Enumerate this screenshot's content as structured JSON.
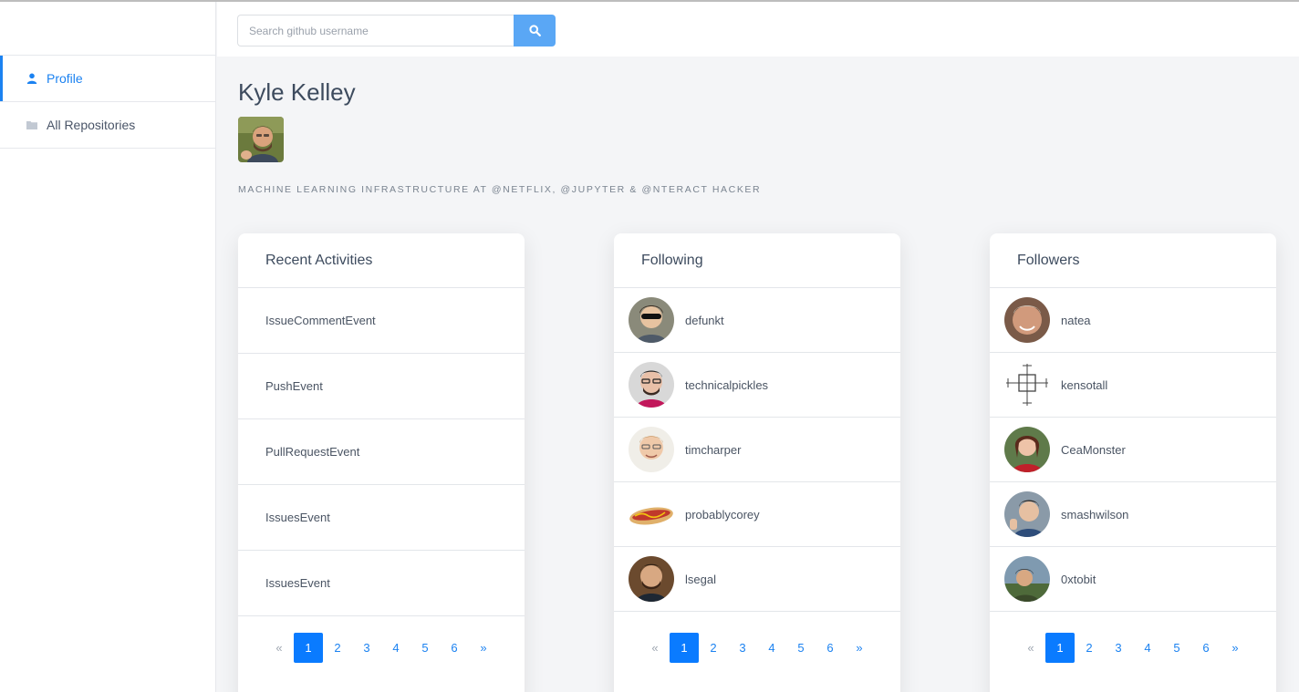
{
  "search": {
    "placeholder": "Search github username"
  },
  "sidebar": {
    "items": [
      {
        "label": "Profile",
        "icon": "user-icon",
        "active": true
      },
      {
        "label": "All Repositories",
        "icon": "folder-icon",
        "active": false
      }
    ]
  },
  "profile": {
    "name": "Kyle Kelley",
    "bio": "MACHINE LEARNING INFRASTRUCTURE AT @NETFLIX, @JUPYTER & @NTERACT HACKER"
  },
  "activities": {
    "title": "Recent Activities",
    "items": [
      "IssueCommentEvent",
      "PushEvent",
      "PullRequestEvent",
      "IssuesEvent",
      "IssuesEvent"
    ]
  },
  "following": {
    "title": "Following",
    "users": [
      "defunkt",
      "technicalpickles",
      "timcharper",
      "probablycorey",
      "lsegal"
    ]
  },
  "followers": {
    "title": "Followers",
    "users": [
      "natea",
      "kensotall",
      "CeaMonster",
      "smashwilson",
      "0xtobit"
    ]
  },
  "pagination": {
    "prev": "«",
    "pages": [
      "1",
      "2",
      "3",
      "4",
      "5",
      "6"
    ],
    "next": "»",
    "current": "1"
  },
  "colors": {
    "accent": "#0a7bff",
    "link": "#1b82f1",
    "search_button": "#5aa7f5"
  }
}
